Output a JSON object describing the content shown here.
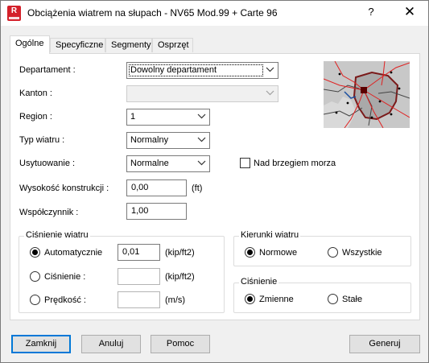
{
  "window": {
    "title": "Obciążenia wiatrem na słupach - NV65 Mod.99 + Carte 96",
    "icon_letter": "R",
    "help_label": "?",
    "close_label": "✕"
  },
  "tabs": [
    {
      "label": "Ogólne",
      "active": true
    },
    {
      "label": "Specyficzne",
      "active": false
    },
    {
      "label": "Segmenty",
      "active": false
    },
    {
      "label": "Osprzęt",
      "active": false
    }
  ],
  "form": {
    "departament": {
      "label": "Departament :",
      "value": "Dowolny departament"
    },
    "kanton": {
      "label": "Kanton :",
      "value": ""
    },
    "region": {
      "label": "Region :",
      "value": "1"
    },
    "typ_wiatru": {
      "label": "Typ wiatru :",
      "value": "Normalny"
    },
    "usytuowanie": {
      "label": "Usytuowanie :",
      "value": "Normalne"
    },
    "nad_brzegiem": {
      "label": "Nad brzegiem morza",
      "checked": false
    },
    "wysokosc": {
      "label": "Wysokość konstrukcji :",
      "value": "0,00",
      "unit": "(ft)"
    },
    "wspolczynnik": {
      "label": "Współczynnik :",
      "value": "1,00"
    }
  },
  "cisnienie_wiatru": {
    "title": "Ciśnienie wiatru",
    "options": [
      {
        "label": "Automatycznie",
        "value": "0,01",
        "unit": "(kip/ft2)",
        "checked": true
      },
      {
        "label": "Ciśnienie :",
        "value": "",
        "unit": "(kip/ft2)",
        "checked": false
      },
      {
        "label": "Prędkość :",
        "value": "",
        "unit": "(m/s)",
        "checked": false
      }
    ]
  },
  "kierunki_wiatru": {
    "title": "Kierunki wiatru",
    "options": [
      {
        "label": "Normowe",
        "checked": true
      },
      {
        "label": "Wszystkie",
        "checked": false
      }
    ]
  },
  "cisnienie": {
    "title": "Ciśnienie",
    "options": [
      {
        "label": "Zmienne",
        "checked": true
      },
      {
        "label": "Stałe",
        "checked": false
      }
    ]
  },
  "buttons": {
    "zamknij": "Zamknij",
    "anuluj": "Anuluj",
    "pomoc": "Pomoc",
    "generuj": "Generuj"
  },
  "colors": {
    "accent": "#0078d7",
    "app_icon": "#d4202a",
    "map_background": "#c8c8c8",
    "map_roads": "#e02020",
    "map_region": "#7a1a1a"
  }
}
